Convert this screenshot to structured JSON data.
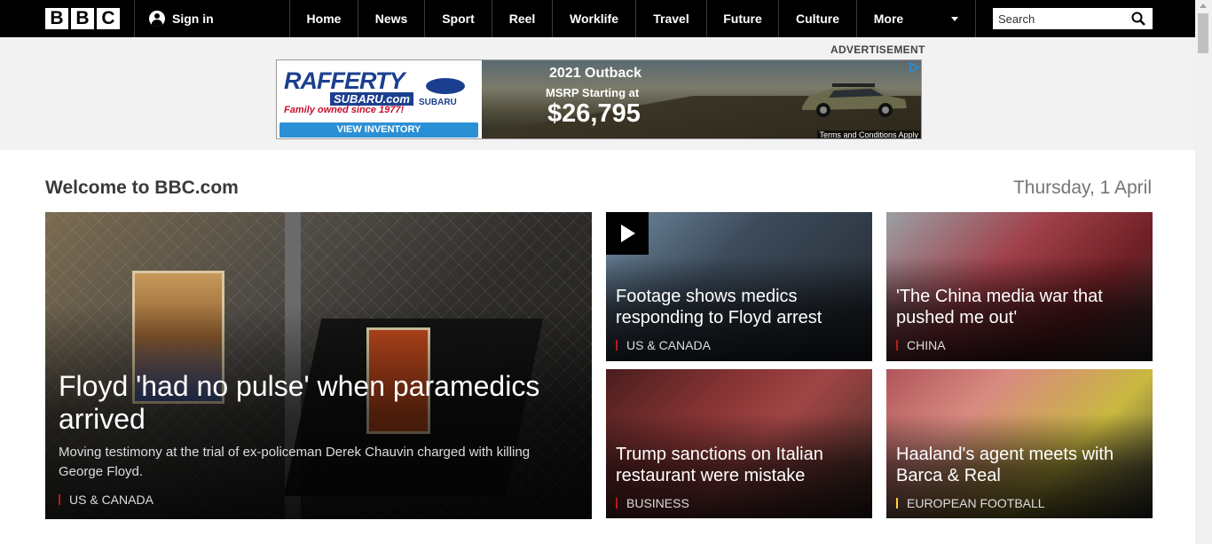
{
  "header": {
    "logo_letters": [
      "B",
      "B",
      "C"
    ],
    "signin_label": "Sign in",
    "nav": [
      "Home",
      "News",
      "Sport",
      "Reel",
      "Worklife",
      "Travel",
      "Future",
      "Culture",
      "More"
    ],
    "search_placeholder": "Search"
  },
  "ad": {
    "label": "ADVERTISEMENT",
    "brand": "RAFFERTY",
    "brand_sub": "SUBARU.com",
    "tagline": "Family owned since 1977!",
    "maker": "SUBARU",
    "cta": "VIEW INVENTORY",
    "model": "2021 Outback",
    "msrp": "MSRP Starting at",
    "price": "$26,795",
    "terms": "Terms and Conditions Apply"
  },
  "main": {
    "welcome": "Welcome to BBC.com",
    "date": "Thursday, 1 April",
    "lead": {
      "headline": "Floyd 'had no pulse' when paramedics arrived",
      "summary": "Moving testimony at the trial of ex-policeman Derek Chauvin charged with killing George Floyd.",
      "tag": "US & CANADA"
    },
    "stories": [
      {
        "headline": "Footage shows medics responding to Floyd arrest",
        "tag": "US & CANADA"
      },
      {
        "headline": "'The China media war that pushed me out'",
        "tag": "CHINA"
      },
      {
        "headline": "Trump sanctions on Italian restaurant were mistake",
        "tag": "BUSINESS"
      },
      {
        "headline": "Haaland's agent meets with Barca & Real",
        "tag": "EUROPEAN FOOTBALL"
      }
    ]
  },
  "colors": {
    "nav_bg": "#000000",
    "tag_accent": "#bb1919",
    "sport_accent": "#ffd230"
  }
}
